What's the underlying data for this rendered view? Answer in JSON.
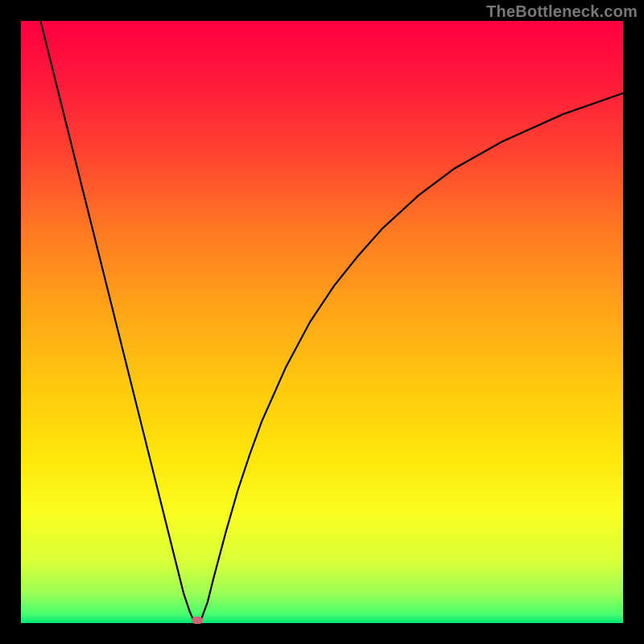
{
  "watermark": {
    "text": "TheBottleneck.com"
  },
  "chart_data": {
    "type": "line",
    "title": "",
    "xlabel": "",
    "ylabel": "",
    "xlim": [
      0,
      100
    ],
    "ylim": [
      0,
      100
    ],
    "x": [
      0,
      2,
      4,
      6,
      8,
      10,
      12,
      14,
      16,
      18,
      20,
      22,
      24,
      26,
      27,
      28,
      28.5,
      29,
      29.5,
      30,
      31,
      32,
      34,
      36,
      38,
      40,
      44,
      48,
      52,
      56,
      60,
      66,
      72,
      80,
      90,
      100
    ],
    "y": [
      113,
      105,
      97,
      89,
      81,
      73,
      65,
      57,
      49,
      41,
      33,
      25,
      17,
      9,
      5,
      2,
      0.8,
      0.15,
      0,
      0.8,
      3.5,
      7.5,
      15,
      22,
      28,
      33.5,
      42.5,
      50,
      56,
      61,
      65.5,
      71,
      75.5,
      80,
      84.5,
      88
    ],
    "gradient_stops": [
      {
        "pos": 0.0,
        "color": "#ff0040"
      },
      {
        "pos": 0.1,
        "color": "#ff1a3a"
      },
      {
        "pos": 0.22,
        "color": "#ff4430"
      },
      {
        "pos": 0.35,
        "color": "#ff7a22"
      },
      {
        "pos": 0.48,
        "color": "#ffa518"
      },
      {
        "pos": 0.6,
        "color": "#ffc80e"
      },
      {
        "pos": 0.72,
        "color": "#ffe60a"
      },
      {
        "pos": 0.82,
        "color": "#faff20"
      },
      {
        "pos": 0.9,
        "color": "#d8ff3a"
      },
      {
        "pos": 0.95,
        "color": "#9cff55"
      },
      {
        "pos": 0.985,
        "color": "#4aff70"
      },
      {
        "pos": 1.0,
        "color": "#00e676"
      }
    ],
    "marker": {
      "x": 29.3,
      "y": 0.5,
      "color": "#cc6677"
    },
    "curve_color": "#000000",
    "curve_width": 2.2
  }
}
